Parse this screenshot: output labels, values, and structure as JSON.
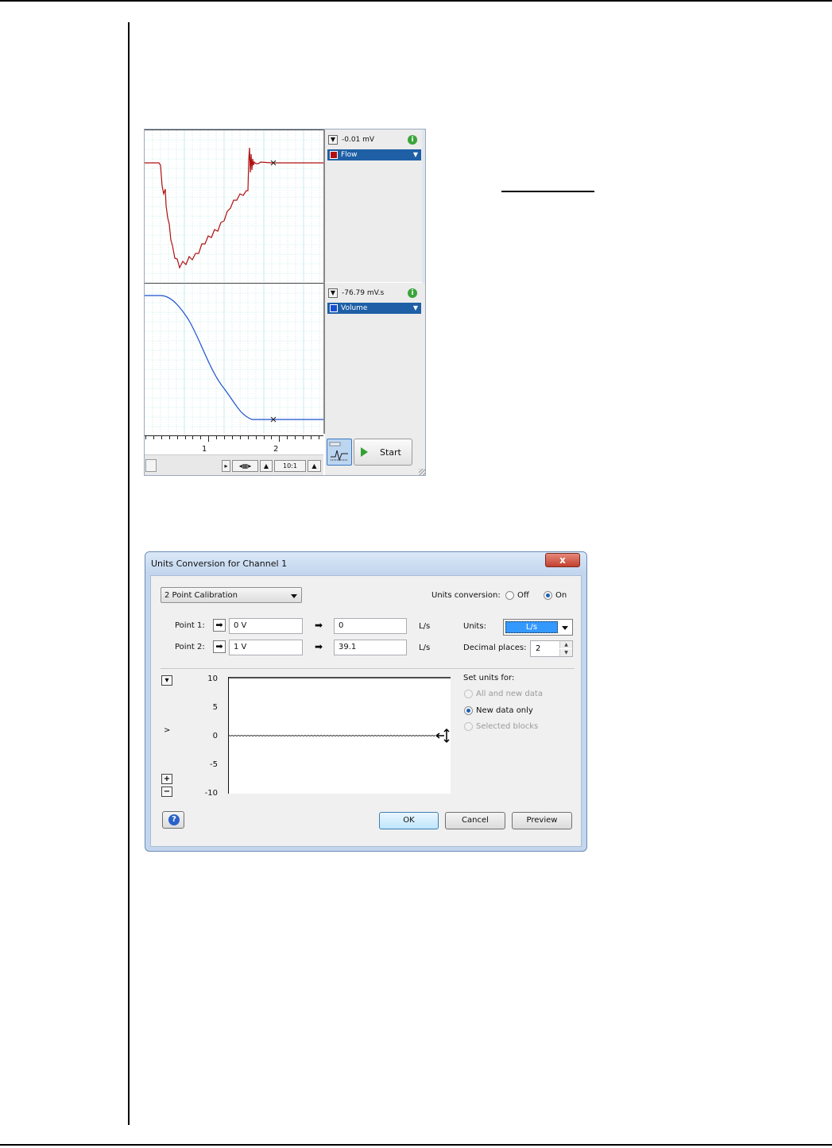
{
  "chart_view": {
    "channels": [
      {
        "value": "-0.01 mV",
        "name": "Flow",
        "color": "#b01010"
      },
      {
        "value": "-76.79 mV.s",
        "name": "Volume",
        "color": "#1a4fd0"
      }
    ],
    "time_ticks": [
      "1",
      "2"
    ],
    "zoom": "10:1",
    "start_label": "Start",
    "colors": {
      "flow": "#b01010",
      "volume": "#1a4fd0",
      "grid": "#9fdede",
      "selected": "#1e5fa6"
    }
  },
  "dialog": {
    "title": "Units Conversion for Channel 1",
    "close_label": "x",
    "mode": "2 Point Calibration",
    "units_conversion_label": "Units conversion:",
    "off_label": "Off",
    "on_label": "On",
    "units_conversion_state": "On",
    "point1": {
      "label": "Point 1:",
      "input": "0 V",
      "output": "0",
      "unit": "L/s"
    },
    "point2": {
      "label": "Point 2:",
      "input": "1 V",
      "output": "39.1",
      "unit": "L/s"
    },
    "units_label": "Units:",
    "units_value": "L/s",
    "decimal_label": "Decimal places:",
    "decimal_value": "2",
    "set_units_label": "Set units for:",
    "set_units_options": [
      {
        "label": "All and new data",
        "selected": false,
        "enabled": false
      },
      {
        "label": "New data only",
        "selected": true,
        "enabled": true
      },
      {
        "label": "Selected blocks",
        "selected": false,
        "enabled": false
      }
    ],
    "plot_y_labels": [
      "10",
      "5",
      "0",
      "-5",
      "-10"
    ],
    "plot_y_unit": ">",
    "ok_label": "OK",
    "cancel_label": "Cancel",
    "preview_label": "Preview"
  }
}
